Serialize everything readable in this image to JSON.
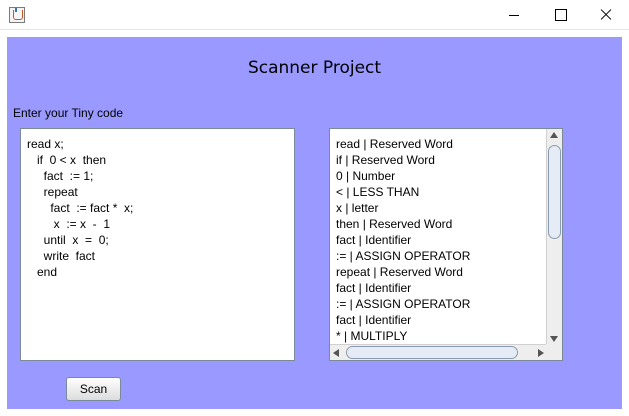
{
  "window": {
    "icon": "java-icon",
    "controls": [
      "minimize-icon",
      "maximize-icon",
      "close-icon"
    ]
  },
  "colors": {
    "background": "#9999ff",
    "panel": "#ffffff"
  },
  "main": {
    "title": "Scanner Project",
    "prompt": "Enter your Tiny code",
    "code_lines": [
      "read x;",
      "   if  0 < x  then",
      "     fact  := 1;",
      "     repeat",
      "       fact  := fact *  x;",
      "        x  := x  -  1",
      "     until  x  =  0;",
      "     write  fact",
      "   end"
    ],
    "output_lines": [
      "read | Reserved Word",
      "if | Reserved Word",
      "0 | Number",
      "< | LESS THAN",
      "x | letter",
      "then | Reserved Word",
      "fact | Identifier",
      ":= | ASSIGN OPERATOR",
      "repeat | Reserved Word",
      "fact | Identifier",
      ":= | ASSIGN OPERATOR",
      "fact | Identifier",
      "* | MULTIPLY"
    ],
    "scan_label": "Scan"
  }
}
